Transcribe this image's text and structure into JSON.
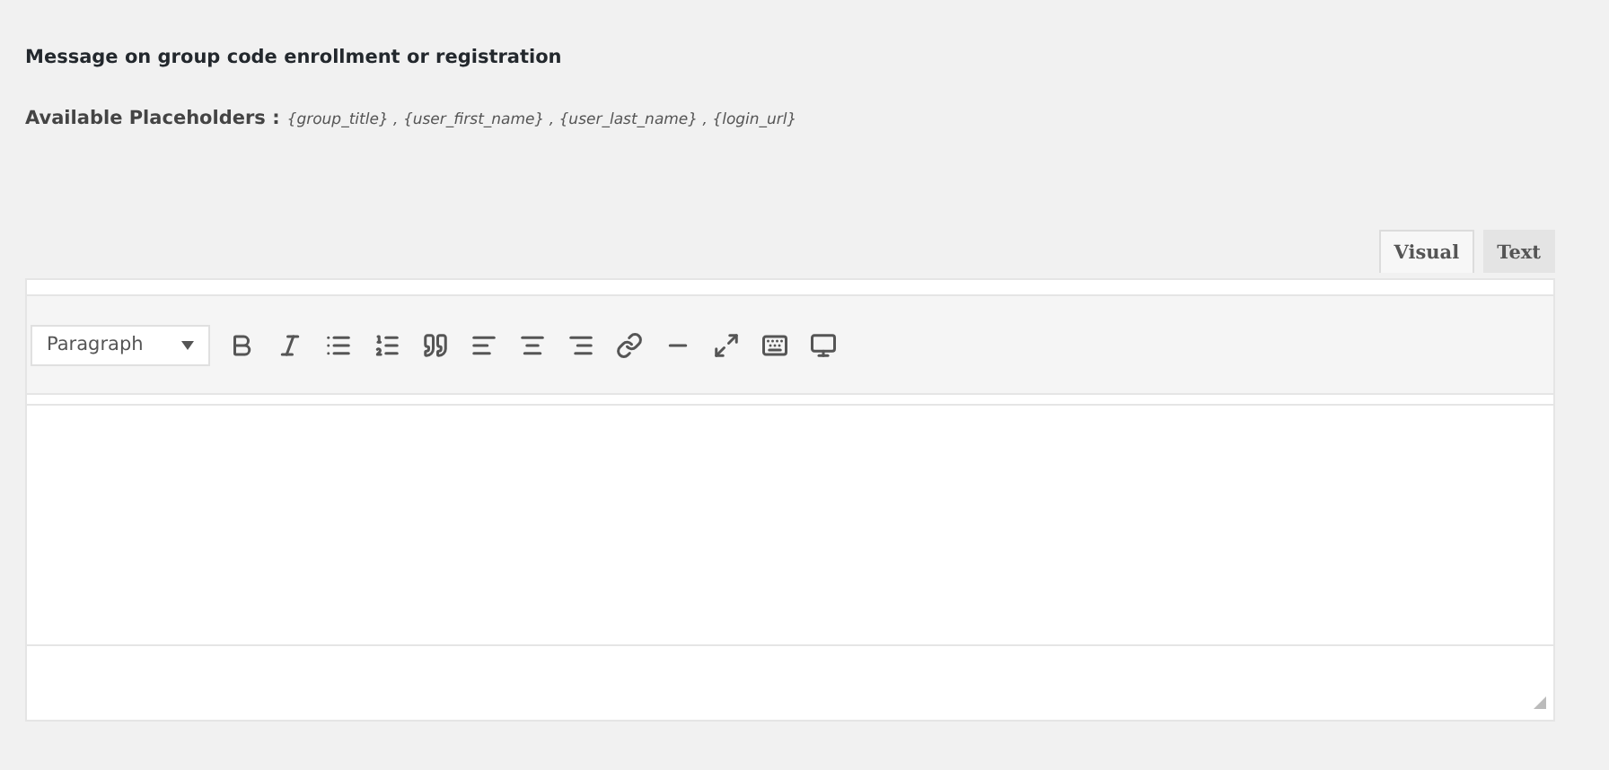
{
  "section_title": "Message on group code enrollment or registration",
  "placeholders": {
    "label": "Available Placeholders :",
    "values": "{group_title} , {user_first_name} , {user_last_name} , {login_url}"
  },
  "editor_tabs": [
    {
      "label": "Visual",
      "selected": true
    },
    {
      "label": "Text",
      "selected": false
    }
  ],
  "editor": {
    "format_select": "Paragraph"
  }
}
